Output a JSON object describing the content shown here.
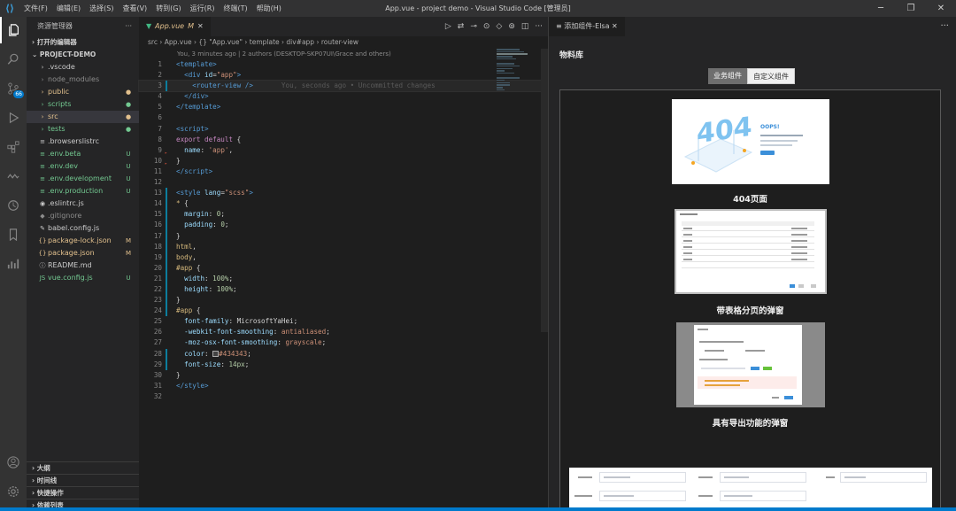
{
  "app": {
    "window_title": "App.vue - project demo - Visual Studio Code [管理员]",
    "menu": [
      "文件(F)",
      "编辑(E)",
      "选择(S)",
      "查看(V)",
      "转到(G)",
      "运行(R)",
      "终端(T)",
      "帮助(H)"
    ],
    "window_controls": [
      "─",
      "❐",
      "✕"
    ]
  },
  "activity_bar": {
    "icons": [
      "files-icon",
      "search-icon",
      "source-control-icon",
      "run-debug-icon",
      "extensions-icon",
      "remote-icon",
      "timeline-icon",
      "bookmark-icon",
      "charts-icon",
      "account-icon",
      "settings-icon"
    ],
    "scm_badge": "66"
  },
  "sidebar": {
    "header": "资源管理器",
    "header_more": "···",
    "open_editors": "打开的编辑器",
    "project": "PROJECT-DEMO",
    "items": [
      {
        "name": ".vscode",
        "icon": "›",
        "status": "",
        "color": "#cccccc",
        "indent": 1
      },
      {
        "name": "node_modules",
        "icon": "›",
        "status": "",
        "color": "#8c8c8c",
        "indent": 1
      },
      {
        "name": "public",
        "icon": "›",
        "status": "●",
        "color": "#e2c08d",
        "indent": 1
      },
      {
        "name": "scripts",
        "icon": "›",
        "status": "●",
        "color": "#73c991",
        "indent": 1
      },
      {
        "name": "src",
        "icon": "›",
        "status": "●",
        "color": "#e2c08d",
        "indent": 1
      },
      {
        "name": "tests",
        "icon": "›",
        "status": "●",
        "color": "#73c991",
        "indent": 1
      },
      {
        "name": ".browserslistrc",
        "icon": "≡",
        "status": "",
        "color": "#cccccc",
        "indent": 1
      },
      {
        "name": ".env.beta",
        "icon": "≡",
        "status": "U",
        "color": "#73c991",
        "indent": 1
      },
      {
        "name": ".env.dev",
        "icon": "≡",
        "status": "U",
        "color": "#73c991",
        "indent": 1
      },
      {
        "name": ".env.development",
        "icon": "≡",
        "status": "U",
        "color": "#73c991",
        "indent": 1
      },
      {
        "name": ".env.production",
        "icon": "≡",
        "status": "U",
        "color": "#73c991",
        "indent": 1
      },
      {
        "name": ".eslintrc.js",
        "icon": "◉",
        "status": "",
        "color": "#cccccc",
        "indent": 1
      },
      {
        "name": ".gitignore",
        "icon": "◆",
        "status": "",
        "color": "#8c8c8c",
        "indent": 1
      },
      {
        "name": "babel.config.js",
        "icon": "✎",
        "status": "",
        "color": "#cccccc",
        "indent": 1
      },
      {
        "name": "package-lock.json",
        "icon": "{}",
        "status": "M",
        "color": "#e2c08d",
        "indent": 1
      },
      {
        "name": "package.json",
        "icon": "{}",
        "status": "M",
        "color": "#e2c08d",
        "indent": 1
      },
      {
        "name": "README.md",
        "icon": "ⓘ",
        "status": "",
        "color": "#cccccc",
        "indent": 1
      },
      {
        "name": "vue.config.js",
        "icon": "JS",
        "status": "U",
        "color": "#73c991",
        "indent": 1
      }
    ],
    "bottom_sections": [
      "大纲",
      "时间线",
      "快捷操作",
      "依赖列表"
    ]
  },
  "editor": {
    "tab_label": "App.vue",
    "tab_status": "M",
    "breadcrumb": "src  ›  App.vue  ›  {} \"App.vue\"  ›  template  ›  div#app  ›  router-view",
    "blame": "You, 3 minutes ago | 2 authors (DESKTOP-SKP07UI\\Grace and others)",
    "ghost_text": "You, seconds ago • Uncommitted changes",
    "line_numbers": [
      "1",
      "2",
      "3",
      "4",
      "5",
      "6",
      "7",
      "8",
      "9",
      "10",
      "11",
      "12",
      "13",
      "14",
      "15",
      "16",
      "17",
      "18",
      "19",
      "20",
      "21",
      "22",
      "23",
      "24",
      "25",
      "26",
      "27",
      "28",
      "29",
      "30",
      "31",
      "32"
    ]
  },
  "right_panel": {
    "tab_label": "添加组件-Elsa",
    "more": "···",
    "title": "物料库",
    "segments": [
      "业务组件",
      "自定义组件"
    ],
    "cards": [
      "404页面",
      "带表格分页的弹窗",
      "具有导出功能的弹窗"
    ],
    "thumb_404": {
      "big": "404",
      "oops": "OOPS!"
    }
  }
}
